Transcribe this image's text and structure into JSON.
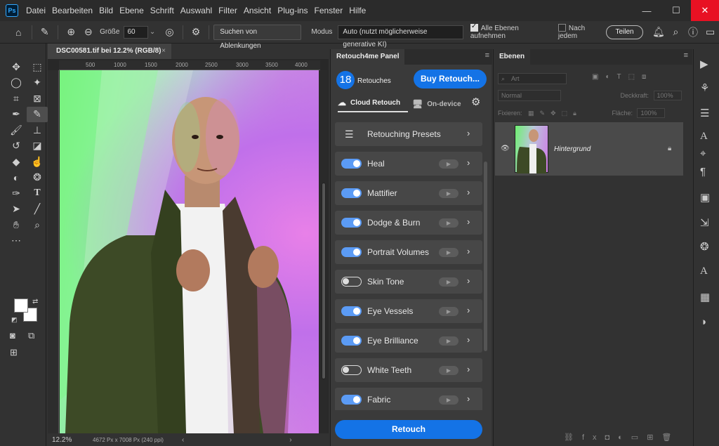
{
  "menubar": {
    "logo": "Ps",
    "items": [
      "Datei",
      "Bearbeiten",
      "Bild",
      "Ebene",
      "Schrift",
      "Auswahl",
      "Filter",
      "Ansicht",
      "Plug-ins",
      "Fenster",
      "Hilfe"
    ]
  },
  "options": {
    "size_label": "Größe",
    "size_value": "60",
    "search_btn": "Suchen von Ablenkungen",
    "mode_label": "Modus",
    "mode_value": "Auto (nutzt möglicherweise generative KI)",
    "all_layers": "Alle Ebenen aufnehmen",
    "after_each": "Nach jedem",
    "share": "Teilen"
  },
  "document": {
    "tab_title": "DSC00581.tif bei 12.2% (RGB/8)",
    "ruler_ticks": [
      "500",
      "1000",
      "1500",
      "2000",
      "2500",
      "3000",
      "3500",
      "4000"
    ],
    "zoom": "12.2%",
    "doc_info": "4672 Px x 7008 Px (240 ppi)"
  },
  "retouch_panel": {
    "title": "Retouch4me Panel",
    "count": "18",
    "count_label": "Retouches",
    "buy": "Buy Retouch...",
    "cloud_tab": "Cloud Retouch",
    "device_tab": "On-device",
    "presets": "Retouching Presets",
    "items": [
      {
        "label": "Heal",
        "on": true
      },
      {
        "label": "Mattifier",
        "on": true
      },
      {
        "label": "Dodge & Burn",
        "on": true
      },
      {
        "label": "Portrait Volumes",
        "on": true
      },
      {
        "label": "Skin Tone",
        "on": false
      },
      {
        "label": "Eye Vessels",
        "on": true
      },
      {
        "label": "Eye Brilliance",
        "on": true
      },
      {
        "label": "White Teeth",
        "on": false
      },
      {
        "label": "Fabric",
        "on": true
      }
    ],
    "retouch_btn": "Retouch"
  },
  "layers_panel": {
    "title": "Ebenen",
    "filter_placeholder": "Art",
    "blend": "Normal",
    "opacity_label": "Deckkraft:",
    "opacity_value": "100%",
    "lock_label": "Fixieren:",
    "fill_label": "Fläche:",
    "fill_value": "100%",
    "layer_name": "Hintergrund"
  },
  "colors": {
    "accent": "#1473e6",
    "toggle_on": "#5b9bf5",
    "close_btn": "#e81123"
  }
}
